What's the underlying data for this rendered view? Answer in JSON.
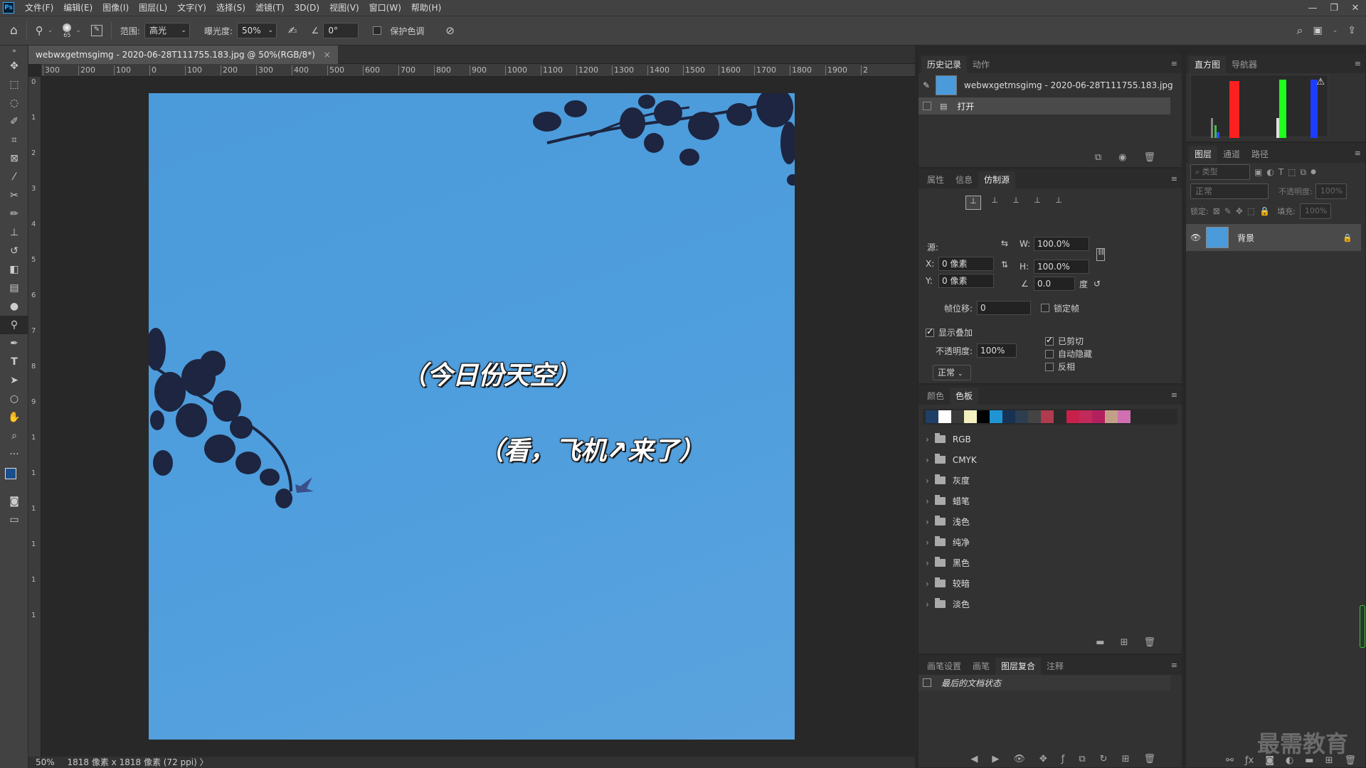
{
  "menu": {
    "app_badge": "Ps",
    "items": [
      "文件(F)",
      "编辑(E)",
      "图像(I)",
      "图层(L)",
      "文字(Y)",
      "选择(S)",
      "滤镜(T)",
      "3D(D)",
      "视图(V)",
      "窗口(W)",
      "帮助(H)"
    ],
    "win_controls": [
      "—",
      "❐",
      "✕"
    ]
  },
  "options": {
    "brush_size": "65",
    "range_label": "范围:",
    "range_value": "高光",
    "exposure_label": "曝光度:",
    "exposure_value": "50%",
    "angle_value": "0°",
    "protect_tones": "保护色调"
  },
  "document": {
    "tab_title": "webwxgetmsgimg - 2020-06-28T111755.183.jpg @ 50%(RGB/8*)",
    "close": "×",
    "caption1": "（今日份天空）",
    "caption2": "（看，飞机↗来了）",
    "status_zoom": "50%",
    "status_info": "1818 像素 x 1818 像素 (72 ppi)",
    "status_arrow": "〉"
  },
  "ruler_h": [
    "300",
    "200",
    "100",
    "0",
    "100",
    "200",
    "300",
    "400",
    "500",
    "600",
    "700",
    "800",
    "900",
    "1000",
    "1100",
    "1200",
    "1300",
    "1400",
    "1500",
    "1600",
    "1700",
    "1800",
    "1900",
    "2"
  ],
  "ruler_v": [
    "0",
    "1",
    "2",
    "3",
    "4",
    "5",
    "6",
    "7",
    "8",
    "9",
    "1",
    "1",
    "1",
    "1",
    "1",
    "1"
  ],
  "history": {
    "tabs": [
      "历史记录",
      "动作"
    ],
    "snapshot_name": "webwxgetmsgimg - 2020-06-28T111755.183.jpg",
    "items": [
      "打开"
    ]
  },
  "clone": {
    "tabs": [
      "属性",
      "信息",
      "仿制源"
    ],
    "source_label": "源:",
    "x_label": "X:",
    "x_value": "0 像素",
    "y_label": "Y:",
    "y_value": "0 像素",
    "w_label": "W:",
    "w_value": "100.0%",
    "h_label": "H:",
    "h_value": "100.0%",
    "angle_value": "0.0",
    "angle_unit": "度",
    "frame_offset_label": "帧位移:",
    "frame_offset_value": "0",
    "lock_frame": "锁定帧",
    "show_overlay": "显示叠加",
    "opacity_label": "不透明度:",
    "opacity_value": "100%",
    "blend_mode": "正常",
    "clipped": "已剪切",
    "auto_hide": "自动隐藏",
    "invert": "反相"
  },
  "swatches": {
    "tabs": [
      "颜色",
      "色板"
    ],
    "colors": [
      "#1f3f66",
      "#ffffff",
      "#3a3a3a",
      "#f4f0c0",
      "#000000",
      "#1f95d4",
      "#173252",
      "#2c3e50",
      "#444444",
      "#b03a4e",
      "#2a2a2a",
      "#c8204a",
      "#c22a5a",
      "#b22060",
      "#c2a088",
      "#d070b0"
    ],
    "groups": [
      "RGB",
      "CMYK",
      "灰度",
      "蜡笔",
      "浅色",
      "纯净",
      "黑色",
      "较暗",
      "淡色"
    ]
  },
  "comps": {
    "tabs": [
      "画笔设置",
      "画笔",
      "图层复合",
      "注释"
    ],
    "item": "最后的文档状态"
  },
  "histogram": {
    "tabs": [
      "直方图",
      "导航器"
    ],
    "warning": "⚠"
  },
  "layers": {
    "tabs": [
      "图层",
      "通道",
      "路径"
    ],
    "filter_placeholder": "类型",
    "blend_mode": "正常",
    "opacity_label": "不透明度:",
    "opacity_value": "100%",
    "lock_label": "锁定:",
    "fill_label": "填充:",
    "fill_value": "100%",
    "layer_name": "背景"
  },
  "watermark": "最需教育"
}
